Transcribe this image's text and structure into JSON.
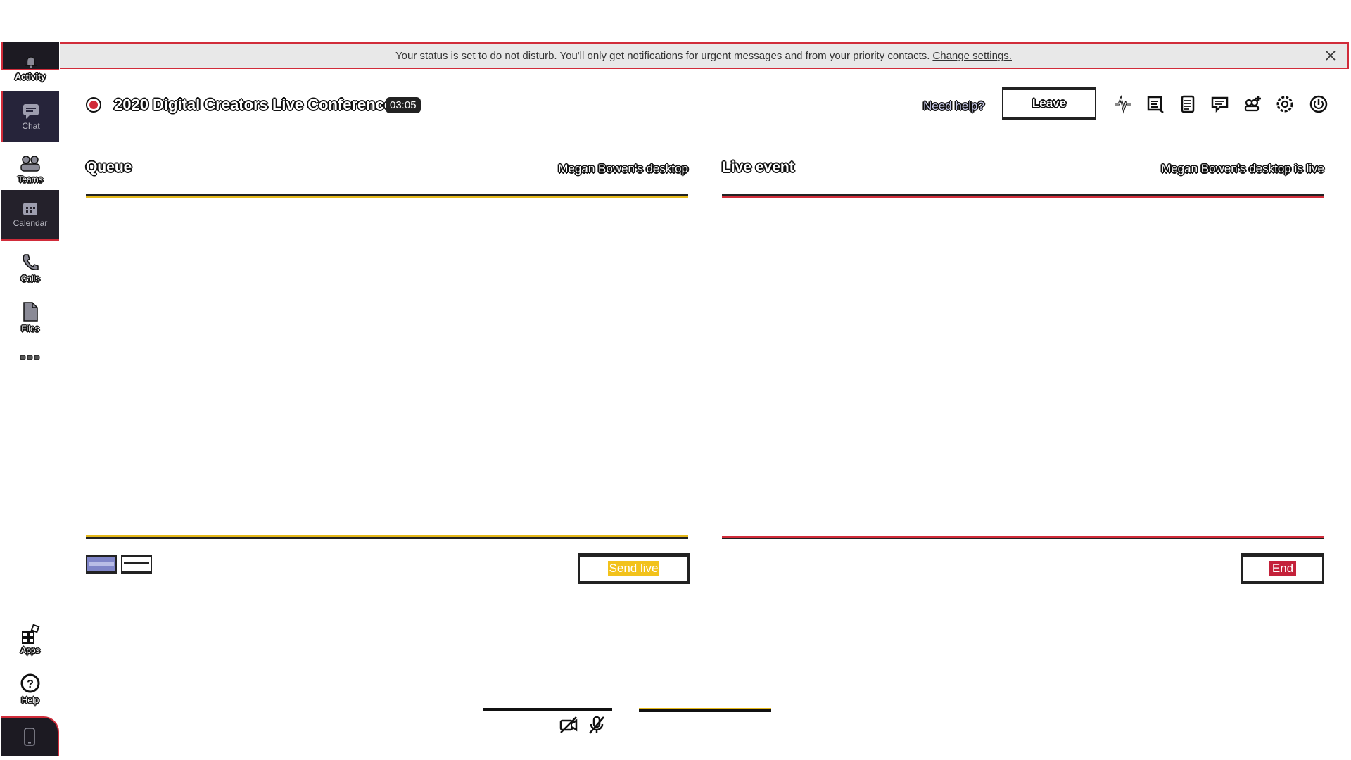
{
  "banner": {
    "message": "Your status is set to do not disturb. You'll only get notifications for urgent messages and from your priority contacts.",
    "link": "Change settings."
  },
  "rail": {
    "items": [
      {
        "label": "Activity",
        "icon": "bell-icon"
      },
      {
        "label": "Chat",
        "icon": "chat-icon"
      },
      {
        "label": "Teams",
        "icon": "teams-icon"
      },
      {
        "label": "Calendar",
        "icon": "calendar-icon"
      },
      {
        "label": "Calls",
        "icon": "phone-icon"
      },
      {
        "label": "Files",
        "icon": "file-icon"
      },
      {
        "label": "",
        "icon": "more-icon"
      },
      {
        "label": "Apps",
        "icon": "apps-icon"
      },
      {
        "label": "Help",
        "icon": "help-icon"
      },
      {
        "label": "",
        "icon": "mobile-icon"
      }
    ]
  },
  "header": {
    "title": "2020 Digital Creators Live Conference",
    "timer": "03:05",
    "need_help": "Need help?",
    "leave": "Leave",
    "icons": [
      "health-icon",
      "transcript-icon",
      "notes-icon",
      "qa-icon",
      "add-people-icon",
      "settings-icon",
      "power-icon"
    ]
  },
  "queue": {
    "title": "Queue",
    "subtitle": "Megan Bowen's desktop",
    "send_live": "Send live"
  },
  "live": {
    "title": "Live event",
    "subtitle": "Megan Bowen's desktop is live",
    "end": "End"
  },
  "bottom": {
    "icons": [
      "camera-off-icon",
      "mic-off-icon"
    ]
  },
  "colors": {
    "accent_yellow": "#f2c21b",
    "accent_red": "#c4213a",
    "rail_dark": "#24212b"
  }
}
